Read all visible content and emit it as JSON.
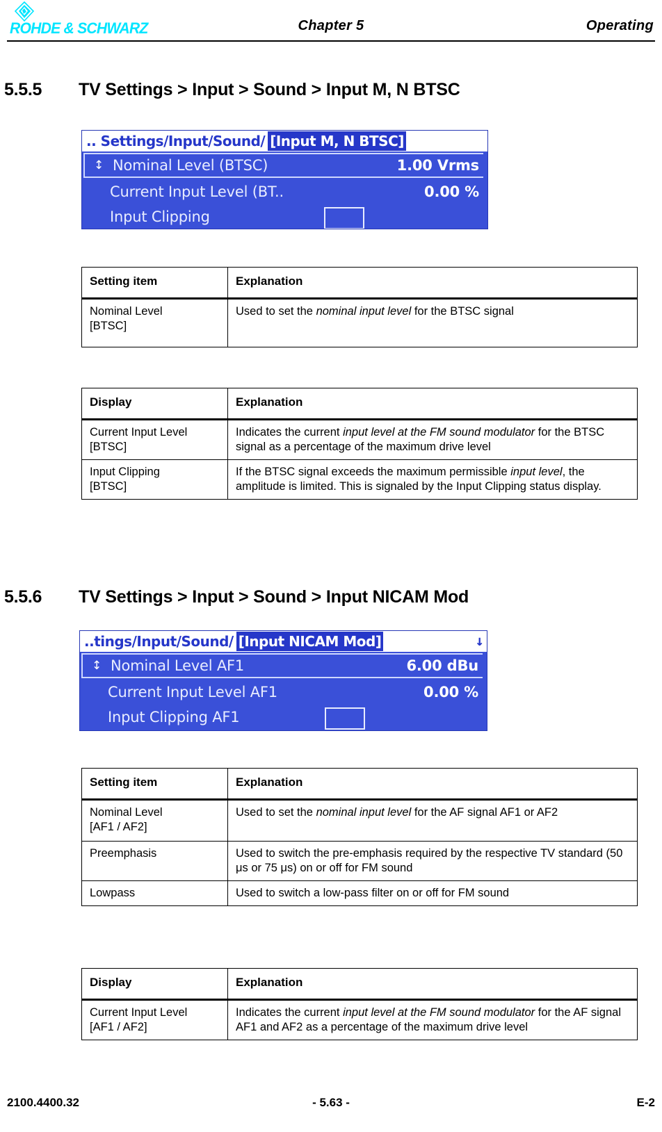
{
  "header": {
    "logo_text": "ROHDE & SCHWARZ",
    "logo_icon": "rs-diamond-logo",
    "chapter": "Chapter 5",
    "right": "Operating"
  },
  "sections": [
    {
      "number": "5.5.5",
      "title": "TV Settings > Input > Sound > Input M, N BTSC"
    },
    {
      "number": "5.5.6",
      "title": "TV Settings > Input > Sound > Input NICAM Mod"
    }
  ],
  "lcd_btsc": {
    "path": ".. Settings/Input/Sound/",
    "window_title": "[Input M, N BTSC]",
    "scroll_indicator": "",
    "rows": [
      {
        "spinner": "↕",
        "label": "Nominal Level (BTSC)",
        "value": "1.00 Vrms",
        "selected": true,
        "checkbox": false
      },
      {
        "spinner": "",
        "label": "Current Input Level (BT..",
        "value": "0.00 %",
        "selected": false,
        "checkbox": false
      },
      {
        "spinner": "",
        "label": "Input Clipping",
        "value": "",
        "selected": false,
        "checkbox": true
      }
    ]
  },
  "lcd_nicam": {
    "path": "..tings/Input/Sound/",
    "window_title": "[Input NICAM Mod]",
    "scroll_indicator": "↓",
    "rows": [
      {
        "spinner": "↕",
        "label": "Nominal Level AF1",
        "value": "6.00 dBu",
        "selected": true,
        "checkbox": false
      },
      {
        "spinner": "",
        "label": "Current Input Level AF1",
        "value": "0.00 %",
        "selected": false,
        "checkbox": false
      },
      {
        "spinner": "",
        "label": "Input Clipping AF1",
        "value": "",
        "selected": false,
        "checkbox": true
      }
    ]
  },
  "tables": {
    "btsc_setting": {
      "headers": {
        "col1": "Setting item",
        "col2": "Explanation"
      },
      "rows": [
        {
          "label": "Nominal Level\n[BTSC]",
          "label_line1": "Nominal Level",
          "label_line2": "[BTSC]",
          "explanation_pre": "Used to set the ",
          "explanation_em": "nominal input level",
          "explanation_post": " for the BTSC signal"
        }
      ]
    },
    "btsc_display": {
      "headers": {
        "col1": "Display",
        "col2": "Explanation"
      },
      "rows": [
        {
          "label_line1": "Current Input Level",
          "label_line2": "[BTSC]",
          "explanation_pre": "Indicates the current ",
          "explanation_em": "input level at the FM sound modulator",
          "explanation_post": " for the BTSC signal as a percentage of the maximum drive level"
        },
        {
          "label_line1": "Input Clipping",
          "label_line2": "[BTSC]",
          "explanation_pre": "If the BTSC signal exceeds the maximum permissible ",
          "explanation_em": "input level",
          "explanation_post": ", the amplitude is limited. This is signaled by the Input Clipping status display."
        }
      ]
    },
    "nicam_setting": {
      "headers": {
        "col1": "Setting item",
        "col2": "Explanation"
      },
      "rows": [
        {
          "label_line1": "Nominal Level",
          "label_line2": "[AF1 / AF2]",
          "explanation_pre": "Used to set the ",
          "explanation_em": "nominal input level",
          "explanation_post": " for the AF signal AF1 or AF2"
        },
        {
          "label_line1": "Preemphasis",
          "label_line2": "",
          "explanation_pre": "Used to switch the pre-emphasis required by the respective TV standard (50 μs or 75 μs) on or off for FM sound",
          "explanation_em": "",
          "explanation_post": ""
        },
        {
          "label_line1": "Lowpass",
          "label_line2": "",
          "explanation_pre": "Used to switch a low-pass filter on or off for FM sound",
          "explanation_em": "",
          "explanation_post": ""
        }
      ]
    },
    "nicam_display": {
      "headers": {
        "col1": "Display",
        "col2": "Explanation"
      },
      "rows": [
        {
          "label_line1": "Current Input Level",
          "label_line2": "[AF1 / AF2]",
          "explanation_pre": "Indicates the current ",
          "explanation_em": "input level at the FM sound modulator",
          "explanation_post": " for the AF signal AF1 and AF2 as a percentage of the maximum drive level"
        }
      ]
    }
  },
  "footer": {
    "left": "2100.4400.32",
    "center": "- 5.63 -",
    "right": "E-2"
  }
}
